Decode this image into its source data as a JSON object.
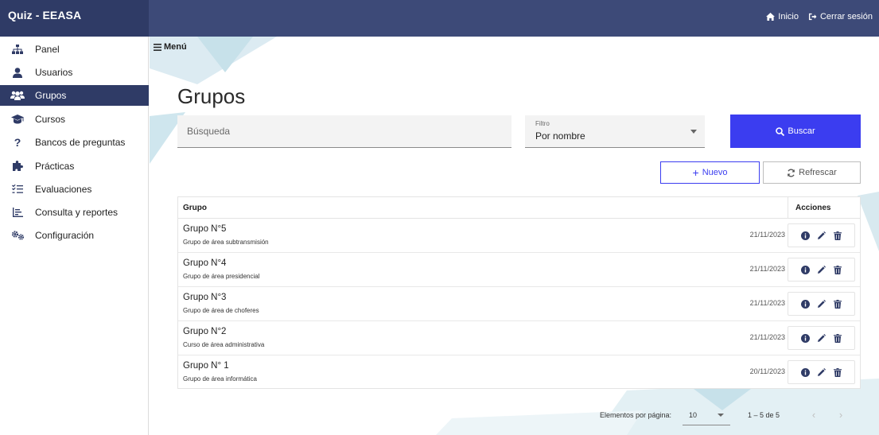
{
  "app": {
    "title": "Quiz - EEASA"
  },
  "topnav": {
    "home": "Inicio",
    "logout": "Cerrar sesión"
  },
  "sidebar": {
    "items": [
      {
        "label": "Panel",
        "icon": "sitemap-icon"
      },
      {
        "label": "Usuarios",
        "icon": "user-icon"
      },
      {
        "label": "Grupos",
        "icon": "users-icon",
        "active": true
      },
      {
        "label": "Cursos",
        "icon": "graduation-cap-icon"
      },
      {
        "label": "Bancos de preguntas",
        "icon": "question-icon"
      },
      {
        "label": "Prácticas",
        "icon": "puzzle-icon"
      },
      {
        "label": "Evaluaciones",
        "icon": "list-check-icon"
      },
      {
        "label": "Consulta y reportes",
        "icon": "chart-icon"
      },
      {
        "label": "Configuración",
        "icon": "gears-icon"
      }
    ]
  },
  "main": {
    "menu_label": "Menú",
    "title": "Grupos",
    "search": {
      "placeholder": "Búsqueda",
      "value": ""
    },
    "filter": {
      "label": "Filtro",
      "value": "Por nombre"
    },
    "buttons": {
      "search": "Buscar",
      "new": "Nuevo",
      "refresh": "Refrescar"
    },
    "table": {
      "headers": {
        "group": "Grupo",
        "actions": "Acciones"
      },
      "rows": [
        {
          "title": "Grupo N°5",
          "subtitle": "Grupo de área subtransmisión",
          "date": "21/11/2023"
        },
        {
          "title": "Grupo N°4",
          "subtitle": "Grupo de área presidencial",
          "date": "21/11/2023"
        },
        {
          "title": "Grupo N°3",
          "subtitle": "Grupo de área de choferes",
          "date": "21/11/2023"
        },
        {
          "title": "Grupo N°2",
          "subtitle": "Curso de área administrativa",
          "date": "21/11/2023"
        },
        {
          "title": "Grupo N° 1",
          "subtitle": "Grupo de área informática",
          "date": "20/11/2023"
        }
      ]
    },
    "paginator": {
      "label": "Elementos por página:",
      "page_size": "10",
      "range": "1 – 5 de 5"
    }
  },
  "colors": {
    "topbar": "#3d4a78",
    "brand": "#2f3b66",
    "accent": "#3b3df0",
    "decor": "#cfe6ee"
  }
}
